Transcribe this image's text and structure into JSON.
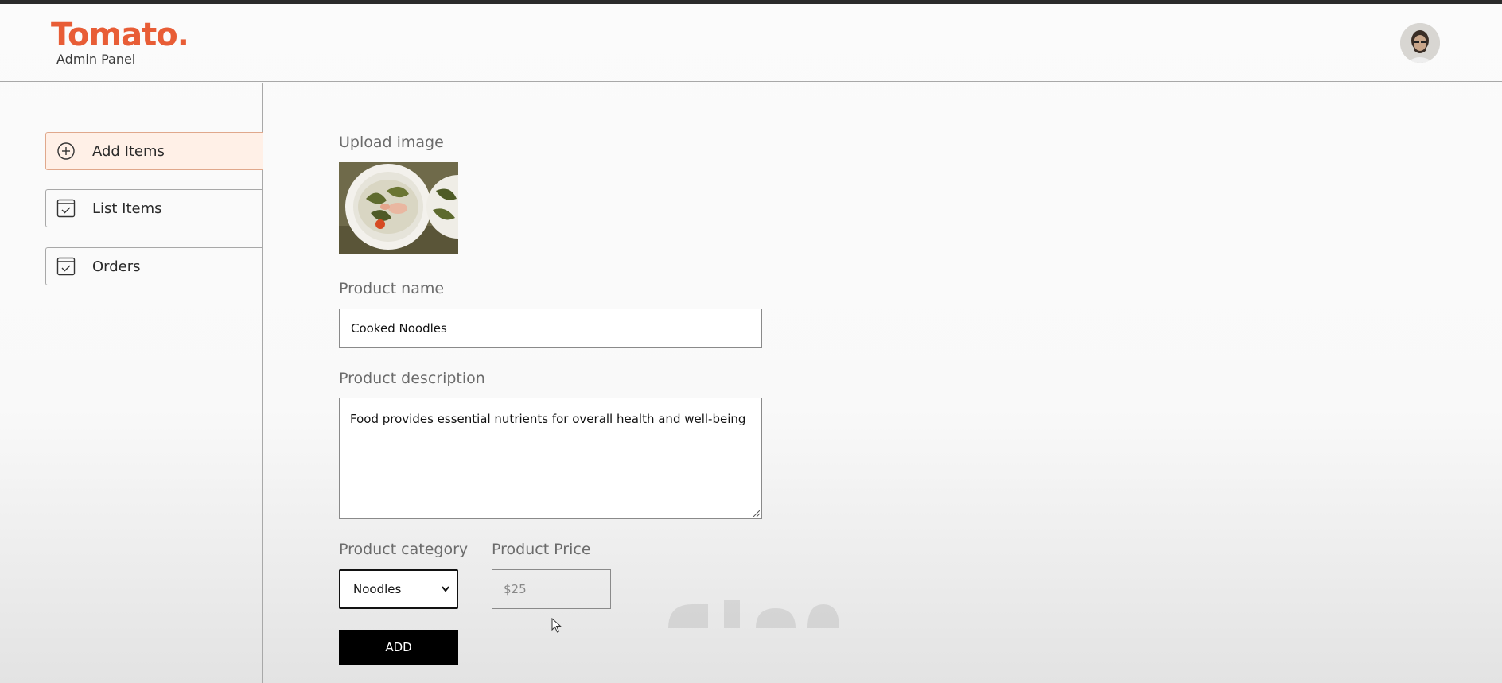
{
  "app": {
    "logo_name": "Tomato.",
    "logo_sub": "Admin Panel"
  },
  "sidebar": {
    "items": [
      {
        "label": "Add Items",
        "icon": "plus-circle-icon",
        "active": true
      },
      {
        "label": "List Items",
        "icon": "checklist-icon",
        "active": false
      },
      {
        "label": "Orders",
        "icon": "checklist-icon",
        "active": false
      }
    ]
  },
  "form": {
    "upload_label": "Upload image",
    "name_label": "Product name",
    "name_value": "Cooked Noodles",
    "description_label": "Product description",
    "description_value": "Food provides essential nutrients for overall health and well-being",
    "category_label": "Product category",
    "category_value": "Noodles",
    "price_label": "Product Price",
    "price_placeholder": "$25",
    "submit_label": "ADD"
  },
  "colors": {
    "brand": "#e85d36",
    "active_item_bg": "#fff0e7",
    "button_bg": "#000000"
  }
}
